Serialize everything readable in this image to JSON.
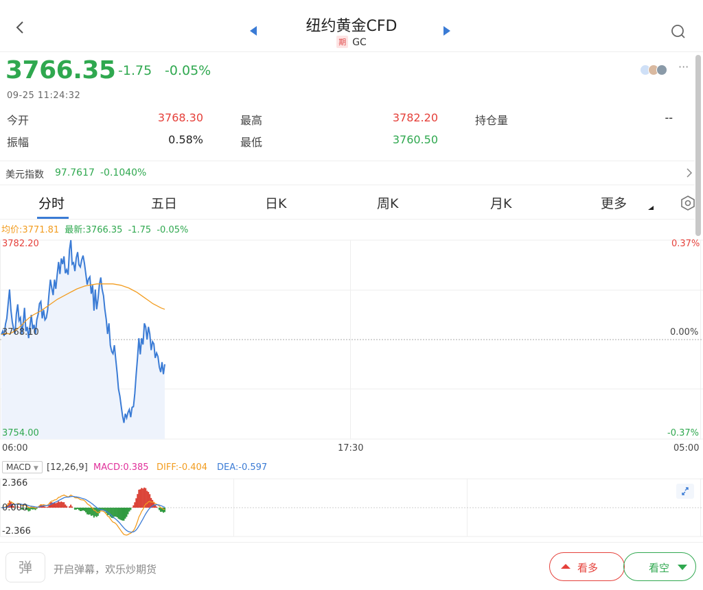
{
  "header": {
    "title": "纽约黄金CFD",
    "tag": "期",
    "symbol": "GC",
    "icons": [
      "chevron-left-icon",
      "triangle-left-icon",
      "triangle-right-icon",
      "search-icon"
    ]
  },
  "quote": {
    "price": "3766.35",
    "change": "-1.75",
    "change_pct": "-0.05%",
    "timestamp": "09-25 11:24:32",
    "more": "···",
    "colors": {
      "down": "#2fa84f",
      "up": "#e5403a",
      "accent": "#3a7bd5"
    }
  },
  "stats": {
    "open_label": "今开",
    "open": "3768.30",
    "high_label": "最高",
    "high": "3782.20",
    "oi_label": "持仓量",
    "oi": "--",
    "amp_label": "振幅",
    "amp": "0.58%",
    "low_label": "最低",
    "low": "3760.50"
  },
  "dxy": {
    "label": "美元指数",
    "value": "97.7617",
    "change": "-0.1040%"
  },
  "tabs": {
    "items": [
      "分时",
      "五日",
      "日K",
      "周K",
      "月K",
      "更多"
    ],
    "active": "分时"
  },
  "legend": {
    "avg": "均价:3771.81",
    "latest": "最新:3766.35",
    "change": "-1.75",
    "pct": "-0.05%"
  },
  "chart_data": {
    "type": "line",
    "y_labels_left": [
      "3782.20",
      "3768.10",
      "3754.00"
    ],
    "y_labels_right": [
      "0.37%",
      "0.00%",
      "-0.37%"
    ],
    "x_labels": [
      "06:00",
      "17:30",
      "05:00"
    ],
    "ylim": [
      3754.0,
      3782.2
    ],
    "baseline": 3768.1,
    "price": [
      3768.8,
      3769.3,
      3768.6,
      3770.3,
      3771.1,
      3773.2,
      3775.2,
      3772.3,
      3770.6,
      3769.6,
      3768.9,
      3771.7,
      3773.1,
      3770.8,
      3771.2,
      3768.9,
      3770.4,
      3772.6,
      3769.3,
      3769.9,
      3768.3,
      3770.0,
      3771.6,
      3769.6,
      3770.2,
      3768.9,
      3770.9,
      3771.7,
      3773.2,
      3773.5,
      3771.1,
      3772.3,
      3770.9,
      3771.2,
      3772.3,
      3774.6,
      3776.6,
      3775.4,
      3774.4,
      3776.6,
      3775.3,
      3777.3,
      3779.1,
      3777.4,
      3779.6,
      3778.8,
      3779.9,
      3777.5,
      3778.0,
      3777.3,
      3780.8,
      3782.2,
      3778.8,
      3779.0,
      3777.8,
      3779.7,
      3780.5,
      3778.7,
      3778.4,
      3779.4,
      3780.0,
      3778.9,
      3777.4,
      3775.9,
      3776.7,
      3777.0,
      3774.6,
      3775.8,
      3772.2,
      3775.2,
      3772.4,
      3773.9,
      3775.9,
      3776.9,
      3775.2,
      3774.3,
      3772.4,
      3771.0,
      3768.9,
      3770.4,
      3767.3,
      3766.4,
      3766.1,
      3767.3,
      3765.3,
      3763.4,
      3761.1,
      3760.1,
      3758.7,
      3757.3,
      3756.3,
      3757.6,
      3757.0,
      3757.8,
      3758.2,
      3757.1,
      3758.5,
      3758.6,
      3760.5,
      3763.1,
      3765.5,
      3768.3,
      3766.0,
      3768.3,
      3767.4,
      3770.4,
      3769.9,
      3768.1,
      3769.9,
      3768.9,
      3766.6,
      3767.8,
      3767.5,
      3765.5,
      3766.2,
      3765.7,
      3764.2,
      3763.5,
      3764.9,
      3763.2,
      3764.6
    ],
    "avg": [
      3768.8,
      3769.0,
      3768.9,
      3769.2,
      3769.6,
      3770.1,
      3770.7,
      3771.2,
      3771.6,
      3771.9,
      3772.2,
      3772.6,
      3773.0,
      3773.4,
      3773.8,
      3774.1,
      3774.4,
      3774.7,
      3775.0,
      3775.3,
      3775.5,
      3775.7,
      3775.8,
      3775.9,
      3776.0,
      3776.0,
      3776.0,
      3776.0,
      3776.0,
      3775.9,
      3775.8,
      3775.6,
      3775.4,
      3775.1,
      3774.8,
      3774.4,
      3774.0,
      3773.6,
      3773.2,
      3772.9,
      3772.6,
      3772.4
    ],
    "macd": {
      "label": "MACD",
      "params": "[12,26,9]",
      "macd_text": "MACD:0.385",
      "diff_text": "DIFF:-0.404",
      "dea_text": "DEA:-0.597",
      "ylim": [
        -2.366,
        2.366
      ],
      "y_labels": [
        "2.366",
        "0.000",
        "-2.366"
      ],
      "colors": {
        "macd": "#e0309a",
        "diff": "#f29c1f",
        "dea": "#3a7bd5"
      }
    }
  },
  "bottom": {
    "danmu_icon_text": "弹",
    "danmu_text": "开启弹幕，欢乐炒期货",
    "bull_label": "看多",
    "bear_label": "看空"
  }
}
